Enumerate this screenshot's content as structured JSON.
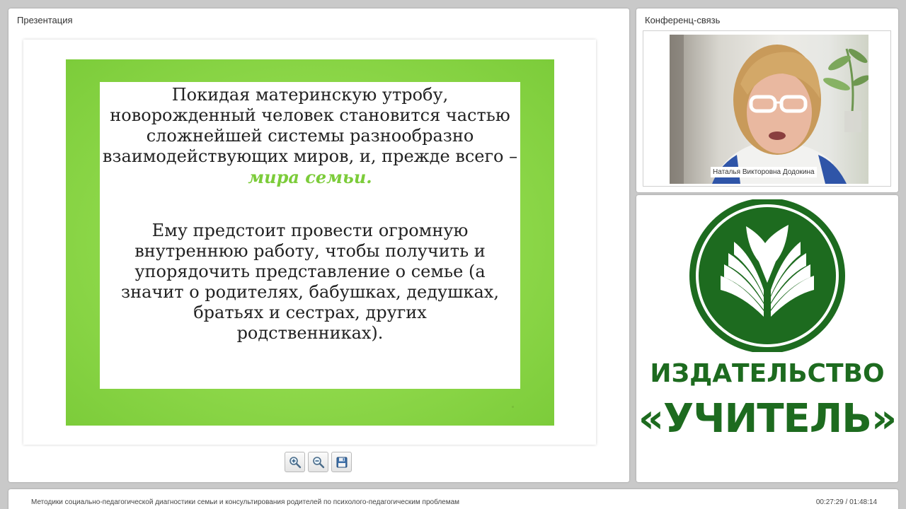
{
  "presentation": {
    "title": "Презентация",
    "slide": {
      "paragraph1": "Покидая материнскую утробу, новорожденный человек становится частью сложнейшей системы разнообразно взаимодействующих миров, и, прежде всего –",
      "paragraph1_accent": "мира семьи.",
      "paragraph2": "Ему предстоит провести огромную внутреннюю работу, чтобы получить и упорядочить представление о семье (а значит о родителях, бабушках, дедушках, братьях и сестрах, других родственниках)."
    },
    "toolbar": {
      "zoom_in_icon": "zoom-in-icon",
      "zoom_out_icon": "zoom-out-icon",
      "save_icon": "floppy-disk-icon"
    }
  },
  "conference": {
    "title": "Конференц-связь",
    "speaker_name": "Наталья Викторовна Додокина"
  },
  "logo": {
    "line1": "ИЗДАТЕЛЬСТВО",
    "line2": "«УЧИТЕЛЬ»",
    "color": "#1d6b1f"
  },
  "footer": {
    "course_title": "Методики социально-педагогической диагностики семьи и консультирования родителей по психолого-педагогическим проблемам",
    "time": "00:27:29 / 01:48:14"
  },
  "colors": {
    "slide_green": "#8ed84a",
    "accent_green": "#7ccc3a",
    "brand_green": "#1d6b1f"
  }
}
